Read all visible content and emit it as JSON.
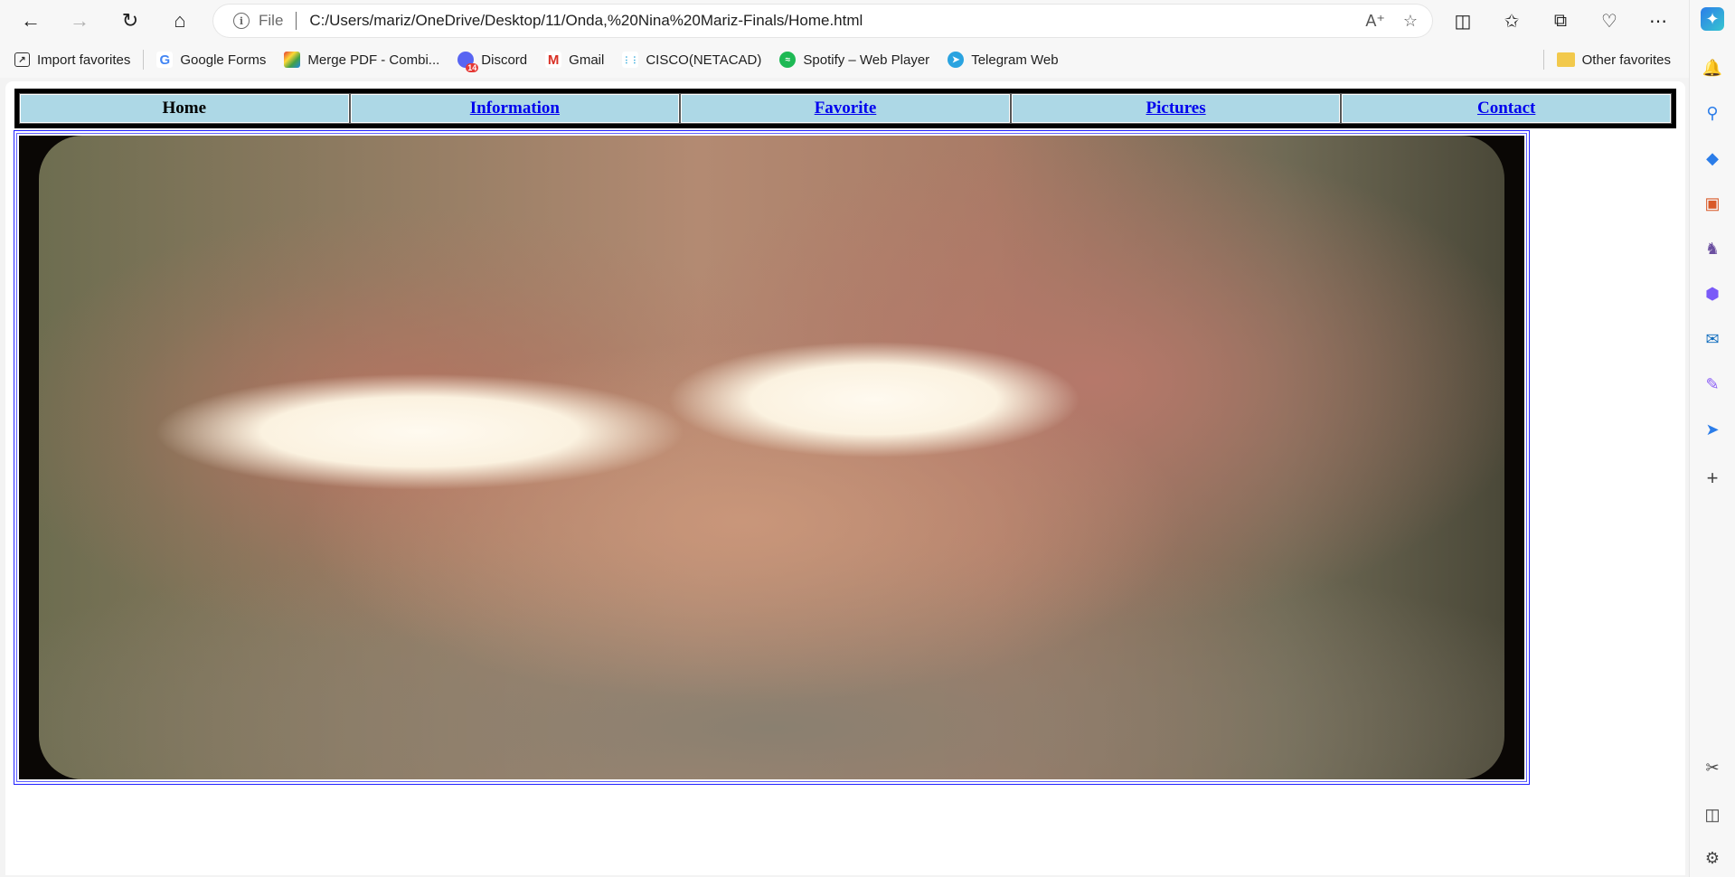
{
  "browser": {
    "scheme_label": "File",
    "url": "C:/Users/mariz/OneDrive/Desktop/11/Onda,%20Nina%20Mariz-Finals/Home.html"
  },
  "favorites": {
    "items": [
      {
        "label": "Import favorites",
        "icon": "import-icon"
      },
      {
        "label": "Google Forms",
        "icon": "google-icon"
      },
      {
        "label": "Merge PDF - Combi...",
        "icon": "merge-pdf-icon"
      },
      {
        "label": "Discord",
        "icon": "discord-icon"
      },
      {
        "label": "Gmail",
        "icon": "gmail-icon"
      },
      {
        "label": "CISCO(NETACAD)",
        "icon": "cisco-icon"
      },
      {
        "label": "Spotify – Web Player",
        "icon": "spotify-icon"
      },
      {
        "label": "Telegram Web",
        "icon": "telegram-icon"
      }
    ],
    "other_label": "Other favorites",
    "discord_badge": "14"
  },
  "page": {
    "nav": [
      {
        "label": "Home",
        "link": false
      },
      {
        "label": "Information",
        "link": true
      },
      {
        "label": "Favorite",
        "link": true
      },
      {
        "label": "Pictures",
        "link": true
      },
      {
        "label": "Contact",
        "link": true
      }
    ],
    "nav_bg_color": "#add8e6",
    "link_color": "#0000ee"
  }
}
